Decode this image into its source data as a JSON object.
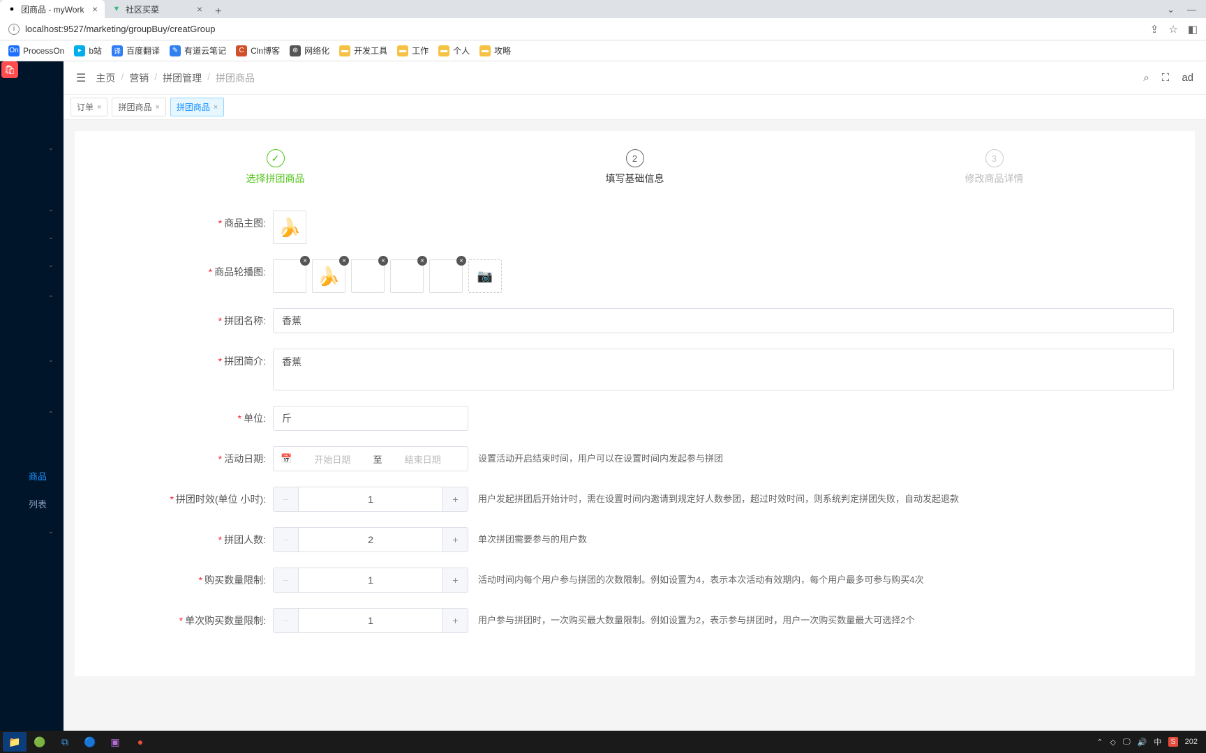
{
  "browser": {
    "tabs": [
      {
        "title": "团商品 - myWork",
        "active": true
      },
      {
        "title": "社区买菜",
        "active": false
      }
    ],
    "url": "localhost:9527/marketing/groupBuy/creatGroup",
    "bookmarks": [
      {
        "label": "ProcessOn",
        "color": "#1e6fff"
      },
      {
        "label": "b站",
        "color": "#00aeec"
      },
      {
        "label": "百度翻译",
        "color": "#2e7cf6"
      },
      {
        "label": "有道云笔记",
        "color": "#3080f0"
      },
      {
        "label": "Cln博客",
        "color": "#d0502b"
      },
      {
        "label": "网络化",
        "color": "#555"
      },
      {
        "label": "开发工具",
        "color": "#f6c244"
      },
      {
        "label": "工作",
        "color": "#f6c244"
      },
      {
        "label": "个人",
        "color": "#f6c244"
      },
      {
        "label": "攻略",
        "color": "#f6c244"
      }
    ]
  },
  "crumbs": [
    "主页",
    "营销",
    "拼团管理",
    "拼团商品"
  ],
  "page_tabs": [
    {
      "label": "订单",
      "active": false
    },
    {
      "label": "拼团商品",
      "active": false
    },
    {
      "label": "拼团商品",
      "active": true
    }
  ],
  "steps": [
    {
      "label": "选择拼团商品",
      "state": "done"
    },
    {
      "label": "填写基础信息",
      "state": "cur",
      "num": "2"
    },
    {
      "label": "修改商品详情",
      "state": "dis",
      "num": "3"
    }
  ],
  "form": {
    "main_img_label": "商品主图:",
    "carousel_label": "商品轮播图:",
    "name_label": "拼团名称:",
    "name_value": "香蕉",
    "intro_label": "拼团简介:",
    "intro_value": "香蕉",
    "unit_label": "单位:",
    "unit_value": "斤",
    "date_label": "活动日期:",
    "date_start_ph": "开始日期",
    "date_to": "至",
    "date_end_ph": "结束日期",
    "date_hint": "设置活动开启结束时间，用户可以在设置时间内发起参与拼团",
    "timeout_label": "拼团时效(单位 小时):",
    "timeout_value": "1",
    "timeout_hint": "用户发起拼团后开始计时，需在设置时间内邀请到规定好人数参团，超过时效时间，则系统判定拼团失败，自动发起退款",
    "people_label": "拼团人数:",
    "people_value": "2",
    "people_hint": "单次拼团需要参与的用户数",
    "buy_limit_label": "购买数量限制:",
    "buy_limit_value": "1",
    "buy_limit_hint": "活动时间内每个用户参与拼团的次数限制。例如设置为4，表示本次活动有效期内，每个用户最多可参与购买4次",
    "single_limit_label": "单次购买数量限制:",
    "single_limit_value": "1",
    "single_limit_hint": "用户参与拼团时，一次购买最大数量限制。例如设置为2，表示参与拼团时，用户一次购买数量最大可选择2个"
  },
  "sidebar": {
    "items": [
      {
        "label": "",
        "chev": true
      },
      {
        "label": "",
        "chev": true
      },
      {
        "label": "",
        "chev": true
      },
      {
        "label": "",
        "chev": true
      },
      {
        "label": "",
        "chev": true
      },
      {
        "label": "",
        "chev": true
      },
      {
        "label": "商品",
        "active": true
      },
      {
        "label": "列表"
      },
      {
        "label": "",
        "chev": true
      }
    ]
  },
  "topbar_user": "ad",
  "taskbar_tray": [
    "中",
    "202"
  ]
}
